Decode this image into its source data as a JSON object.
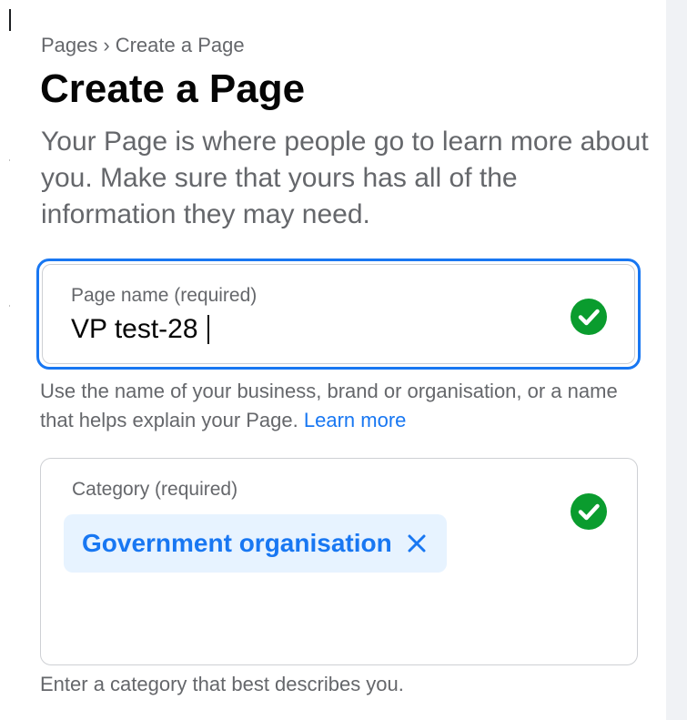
{
  "breadcrumb": {
    "parent": "Pages",
    "separator": "›",
    "current": "Create a Page"
  },
  "header": {
    "title": "Create a Page",
    "subtitle": "Your Page is where people go to learn more about you. Make sure that yours has all of the information they may need."
  },
  "page_name": {
    "label": "Page name (required)",
    "value": "VP test-28",
    "valid": true,
    "helper_text": "Use the name of your business, brand or organisation, or a name that helps explain your Page.",
    "learn_more": "Learn more"
  },
  "category": {
    "label": "Category (required)",
    "selected": [
      "Government organisation"
    ],
    "valid": true,
    "helper_text": "Enter a category that best describes you."
  },
  "icons": {
    "valid": "check-circle-icon",
    "remove": "close-icon"
  },
  "colors": {
    "accent": "#1877f2",
    "success": "#0a9c2e",
    "chip_background": "#e7f3ff",
    "secondary_text": "#65676b",
    "primary_text": "#050505",
    "border": "#ced0d4"
  }
}
